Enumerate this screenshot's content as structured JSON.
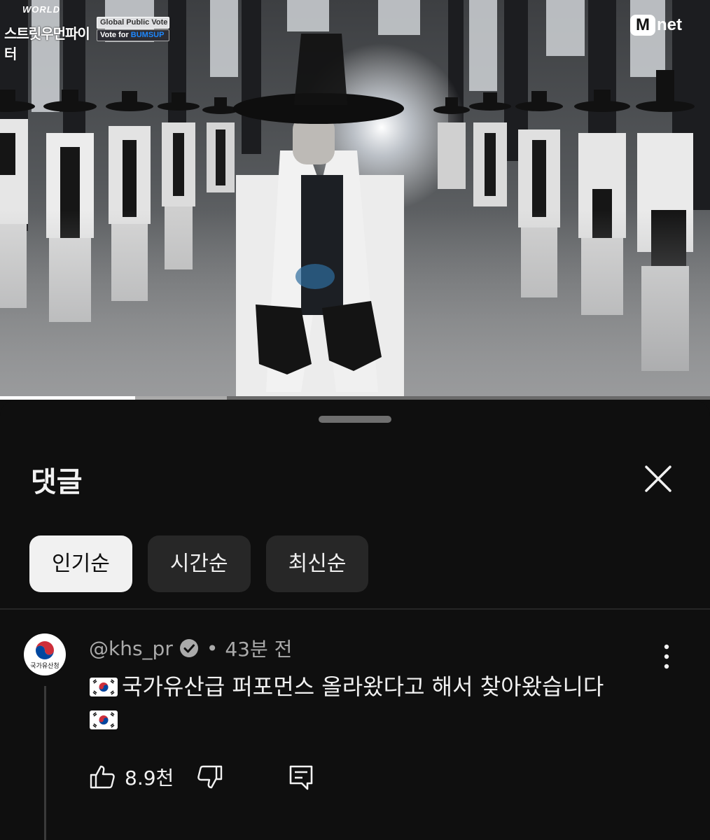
{
  "video": {
    "show_logo_line1": "WORLD",
    "show_logo_line2": "스트릿우먼파이터",
    "vote_line1": "Global Public Vote",
    "vote_line2_prefix": "Vote for ",
    "vote_line2_name": "BUMSUP",
    "channel_logo_m": "M",
    "channel_logo_text": "net",
    "progress": 0.19,
    "buffered": 0.32
  },
  "comments_sheet": {
    "title": "댓글",
    "close_icon": "close-icon",
    "sort_chips": [
      {
        "label": "인기순",
        "active": true
      },
      {
        "label": "시간순",
        "active": false
      },
      {
        "label": "최신순",
        "active": false
      }
    ]
  },
  "comment": {
    "avatar_text": "국가유산청",
    "author": "@khs_pr",
    "verified_icon": "verified-check-icon",
    "separator": "•",
    "time": "43분 전",
    "text": "국가유산급 퍼포먼스 올라왔다고 해서 찾아왔습니다",
    "flag_icon": "south-korea-flag-icon",
    "like_count": "8.9천",
    "icons": [
      "like-icon",
      "dislike-icon",
      "reply-icon",
      "more-options-icon"
    ]
  }
}
